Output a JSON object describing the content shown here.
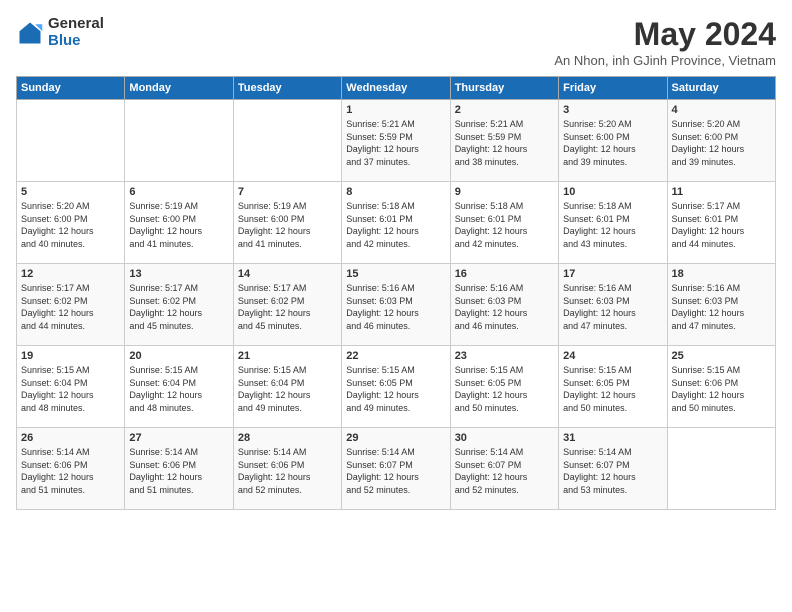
{
  "logo": {
    "general": "General",
    "blue": "Blue"
  },
  "title": "May 2024",
  "subtitle": "An Nhon, inh GJinh Province, Vietnam",
  "days_of_week": [
    "Sunday",
    "Monday",
    "Tuesday",
    "Wednesday",
    "Thursday",
    "Friday",
    "Saturday"
  ],
  "weeks": [
    [
      {
        "day": "",
        "info": ""
      },
      {
        "day": "",
        "info": ""
      },
      {
        "day": "",
        "info": ""
      },
      {
        "day": "1",
        "info": "Sunrise: 5:21 AM\nSunset: 5:59 PM\nDaylight: 12 hours\nand 37 minutes."
      },
      {
        "day": "2",
        "info": "Sunrise: 5:21 AM\nSunset: 5:59 PM\nDaylight: 12 hours\nand 38 minutes."
      },
      {
        "day": "3",
        "info": "Sunrise: 5:20 AM\nSunset: 6:00 PM\nDaylight: 12 hours\nand 39 minutes."
      },
      {
        "day": "4",
        "info": "Sunrise: 5:20 AM\nSunset: 6:00 PM\nDaylight: 12 hours\nand 39 minutes."
      }
    ],
    [
      {
        "day": "5",
        "info": "Sunrise: 5:20 AM\nSunset: 6:00 PM\nDaylight: 12 hours\nand 40 minutes."
      },
      {
        "day": "6",
        "info": "Sunrise: 5:19 AM\nSunset: 6:00 PM\nDaylight: 12 hours\nand 41 minutes."
      },
      {
        "day": "7",
        "info": "Sunrise: 5:19 AM\nSunset: 6:00 PM\nDaylight: 12 hours\nand 41 minutes."
      },
      {
        "day": "8",
        "info": "Sunrise: 5:18 AM\nSunset: 6:01 PM\nDaylight: 12 hours\nand 42 minutes."
      },
      {
        "day": "9",
        "info": "Sunrise: 5:18 AM\nSunset: 6:01 PM\nDaylight: 12 hours\nand 42 minutes."
      },
      {
        "day": "10",
        "info": "Sunrise: 5:18 AM\nSunset: 6:01 PM\nDaylight: 12 hours\nand 43 minutes."
      },
      {
        "day": "11",
        "info": "Sunrise: 5:17 AM\nSunset: 6:01 PM\nDaylight: 12 hours\nand 44 minutes."
      }
    ],
    [
      {
        "day": "12",
        "info": "Sunrise: 5:17 AM\nSunset: 6:02 PM\nDaylight: 12 hours\nand 44 minutes."
      },
      {
        "day": "13",
        "info": "Sunrise: 5:17 AM\nSunset: 6:02 PM\nDaylight: 12 hours\nand 45 minutes."
      },
      {
        "day": "14",
        "info": "Sunrise: 5:17 AM\nSunset: 6:02 PM\nDaylight: 12 hours\nand 45 minutes."
      },
      {
        "day": "15",
        "info": "Sunrise: 5:16 AM\nSunset: 6:03 PM\nDaylight: 12 hours\nand 46 minutes."
      },
      {
        "day": "16",
        "info": "Sunrise: 5:16 AM\nSunset: 6:03 PM\nDaylight: 12 hours\nand 46 minutes."
      },
      {
        "day": "17",
        "info": "Sunrise: 5:16 AM\nSunset: 6:03 PM\nDaylight: 12 hours\nand 47 minutes."
      },
      {
        "day": "18",
        "info": "Sunrise: 5:16 AM\nSunset: 6:03 PM\nDaylight: 12 hours\nand 47 minutes."
      }
    ],
    [
      {
        "day": "19",
        "info": "Sunrise: 5:15 AM\nSunset: 6:04 PM\nDaylight: 12 hours\nand 48 minutes."
      },
      {
        "day": "20",
        "info": "Sunrise: 5:15 AM\nSunset: 6:04 PM\nDaylight: 12 hours\nand 48 minutes."
      },
      {
        "day": "21",
        "info": "Sunrise: 5:15 AM\nSunset: 6:04 PM\nDaylight: 12 hours\nand 49 minutes."
      },
      {
        "day": "22",
        "info": "Sunrise: 5:15 AM\nSunset: 6:05 PM\nDaylight: 12 hours\nand 49 minutes."
      },
      {
        "day": "23",
        "info": "Sunrise: 5:15 AM\nSunset: 6:05 PM\nDaylight: 12 hours\nand 50 minutes."
      },
      {
        "day": "24",
        "info": "Sunrise: 5:15 AM\nSunset: 6:05 PM\nDaylight: 12 hours\nand 50 minutes."
      },
      {
        "day": "25",
        "info": "Sunrise: 5:15 AM\nSunset: 6:06 PM\nDaylight: 12 hours\nand 50 minutes."
      }
    ],
    [
      {
        "day": "26",
        "info": "Sunrise: 5:14 AM\nSunset: 6:06 PM\nDaylight: 12 hours\nand 51 minutes."
      },
      {
        "day": "27",
        "info": "Sunrise: 5:14 AM\nSunset: 6:06 PM\nDaylight: 12 hours\nand 51 minutes."
      },
      {
        "day": "28",
        "info": "Sunrise: 5:14 AM\nSunset: 6:06 PM\nDaylight: 12 hours\nand 52 minutes."
      },
      {
        "day": "29",
        "info": "Sunrise: 5:14 AM\nSunset: 6:07 PM\nDaylight: 12 hours\nand 52 minutes."
      },
      {
        "day": "30",
        "info": "Sunrise: 5:14 AM\nSunset: 6:07 PM\nDaylight: 12 hours\nand 52 minutes."
      },
      {
        "day": "31",
        "info": "Sunrise: 5:14 AM\nSunset: 6:07 PM\nDaylight: 12 hours\nand 53 minutes."
      },
      {
        "day": "",
        "info": ""
      }
    ]
  ]
}
